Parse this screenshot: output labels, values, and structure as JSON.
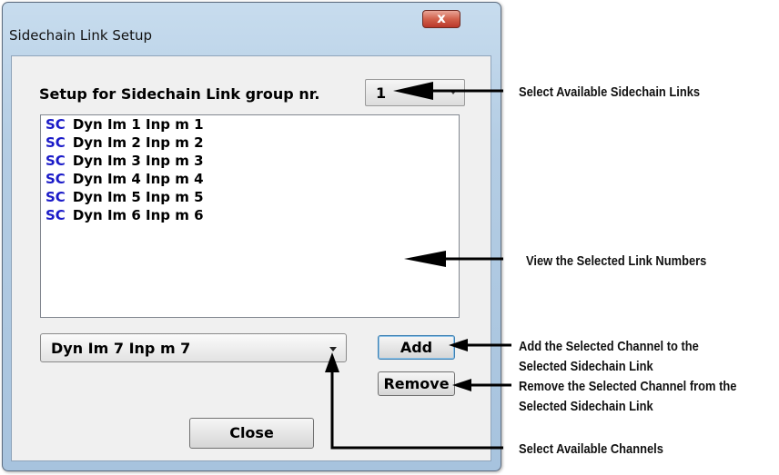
{
  "window": {
    "title": "Sidechain Link Setup",
    "close_glyph": "x"
  },
  "setup": {
    "label": "Setup for Sidechain Link group nr.",
    "group_value": "1"
  },
  "links": [
    {
      "tag": "SC",
      "text": "Dyn Im 1 Inp m  1"
    },
    {
      "tag": "SC",
      "text": "Dyn Im 2 Inp m  2"
    },
    {
      "tag": "SC",
      "text": "Dyn Im 3 Inp m  3"
    },
    {
      "tag": "SC",
      "text": "Dyn Im 4 Inp m  4"
    },
    {
      "tag": "SC",
      "text": "Dyn Im 5 Inp m  5"
    },
    {
      "tag": "SC",
      "text": "Dyn Im 6 Inp m  6"
    }
  ],
  "channel_select": {
    "value": "Dyn Im 7 Inp m  7"
  },
  "buttons": {
    "add": "Add",
    "remove": "Remove",
    "close": "Close"
  },
  "annotations": {
    "select_links": "Select Available Sidechain Links",
    "view_numbers": "View the Selected Link Numbers",
    "add_line1": "Add the Selected Channel to the",
    "add_line2": "Selected  Sidechain Link",
    "remove_line1": "Remove the Selected Channel from the",
    "remove_line2": "Selected  Sidechain Link",
    "select_channels": "Select Available Channels"
  },
  "colors": {
    "sc_tag": "#1a1ac8",
    "close_button": "#c9483a",
    "window_frame": "#b4cde4"
  }
}
